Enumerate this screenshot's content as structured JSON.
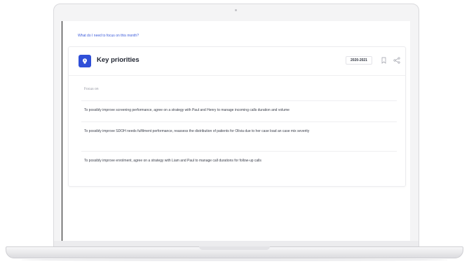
{
  "question": "What do I need to focus on this month?",
  "card": {
    "title": "Key priorities",
    "year": "2020-2021",
    "focus_label": "Focus on",
    "items": [
      {
        "text": "To possibly improve screening performance, agree on a strategy with Paul and Henry to manage incoming calls duration and volume"
      },
      {
        "text": "To possibly improve SDOH needs fulfilment performance, reassess the distribution of patients for Olivia due to her case load an case mix severity"
      },
      {
        "text": "To possibly improve enrolment, agree on a strategy with Liam and Paul to manage call durations for follow-up calls"
      }
    ]
  },
  "colors": {
    "accent": "#2f4fd8",
    "link": "#3b5bdb"
  },
  "icons": [
    "lightbulb-icon",
    "bookmark-icon",
    "share-icon"
  ]
}
